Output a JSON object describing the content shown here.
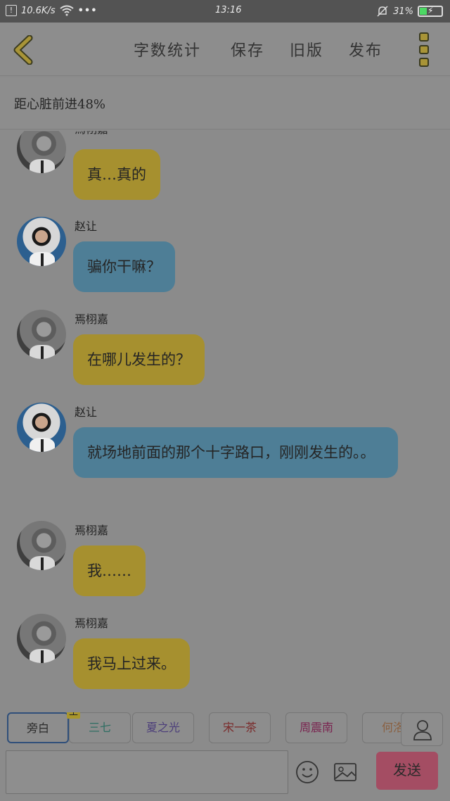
{
  "status": {
    "speed": "10.6K/s",
    "time": "13:16",
    "battery": "31%"
  },
  "header": {
    "word_count": "字数统计",
    "save": "保存",
    "old_version": "旧版",
    "publish": "发布"
  },
  "progress_text": "距心脏前进48%",
  "messages": [
    {
      "sender": "焉栩嘉",
      "text": "真…真的",
      "color": "#a6902f"
    },
    {
      "sender": "赵让",
      "text": "骗你干嘛？",
      "color": "#4e7e96"
    },
    {
      "sender": "焉栩嘉",
      "text": "在哪儿发生的？",
      "color": "#a6902f"
    },
    {
      "sender": "赵让",
      "text": "就场地前面的那个十字路口，刚刚发生的。。",
      "color": "#4e7e96"
    },
    {
      "sender": "焉栩嘉",
      "text": "我……",
      "color": "#a6902f"
    },
    {
      "sender": "焉栩嘉",
      "text": "我马上过来。",
      "color": "#a6902f"
    }
  ],
  "roles": [
    {
      "label": "旁白",
      "color": "#2b2b2b"
    },
    {
      "label": "三七",
      "color": "#2f6e63",
      "tag": "主"
    },
    {
      "label": "夏之光",
      "color": "#4b3d7a"
    },
    {
      "label": "宋一茶",
      "color": "#7a2a2a"
    },
    {
      "label": "周震南",
      "color": "#7a2450"
    },
    {
      "label": "何洛",
      "color": "#8a6040"
    }
  ],
  "send_label": "发送",
  "icons": {
    "back": "back-arrow-icon",
    "menu": "more-menu-icon",
    "person": "person-icon",
    "emoji": "emoji-icon",
    "image": "image-icon"
  }
}
